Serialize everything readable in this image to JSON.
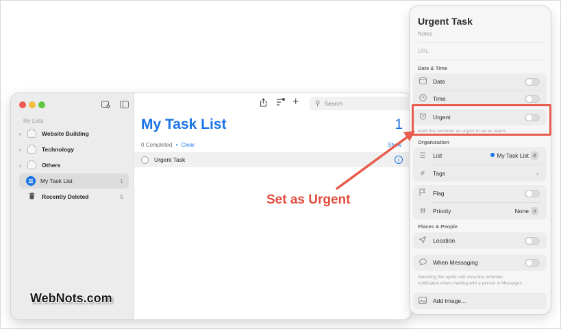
{
  "sidebar": {
    "header": "My Lists",
    "groups": [
      {
        "label": "Website Building"
      },
      {
        "label": "Technology"
      },
      {
        "label": "Others"
      }
    ],
    "lists": [
      {
        "label": "My Task List",
        "count": "1"
      },
      {
        "label": "Recently Deleted",
        "count": "5"
      }
    ]
  },
  "toolbar": {
    "search_placeholder": "Search"
  },
  "main": {
    "title": "My Task List",
    "count": "1",
    "completed_text": "0 Completed",
    "separator": "•",
    "clear_label": "Clear",
    "show_label": "Show",
    "task": {
      "label": "Urgent Task"
    }
  },
  "panel": {
    "title": "Urgent Task",
    "notes": "Notes",
    "url": "URL",
    "date_time_header": "Date & Time",
    "date_label": "Date",
    "time_label": "Time",
    "urgent_label": "Urgent",
    "urgent_hint": "Mark this reminder as urgent to set an alarm.",
    "organization_header": "Organization",
    "list_label": "List",
    "list_value": "My Task List",
    "tags_label": "Tags",
    "flag_label": "Flag",
    "priority_label": "Priority",
    "priority_value": "None",
    "places_header": "Places & People",
    "location_label": "Location",
    "messaging_label": "When Messaging",
    "messaging_hint_1": "Selecting this option will show the reminder",
    "messaging_hint_2": "notification when chatting with a person in Messages.",
    "add_image_label": "Add Image..."
  },
  "annotation": {
    "text": "Set as Urgent",
    "color": "#e14d3e"
  },
  "watermark": "WebNots.com",
  "colors": {
    "accent": "#1a73e8",
    "highlight": "#e85a4b"
  }
}
